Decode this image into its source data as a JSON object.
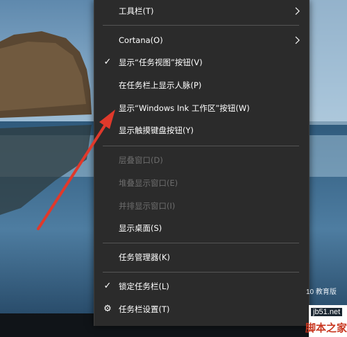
{
  "menu": {
    "toolbar_label": "工具栏(T)",
    "cortana_label": "Cortana(O)",
    "task_view_label": "显示“任务视图”按钮(V)",
    "people_label": "在任务栏上显示人脉(P)",
    "ink_label": "显示“Windows Ink 工作区”按钮(W)",
    "touch_kbd_label": "显示触摸键盘按钮(Y)",
    "cascade_label": "层叠窗口(D)",
    "stacked_label": "堆叠显示窗口(E)",
    "side_by_side_label": "并排显示窗口(I)",
    "show_desktop_label": "显示桌面(S)",
    "task_manager_label": "任务管理器(K)",
    "lock_taskbar_label": "锁定任务栏(L)",
    "taskbar_settings_label": "任务栏设置(T)"
  },
  "watermark": {
    "left_text": "10 教育版",
    "site": "jb51.net",
    "brand": "脚本之家"
  },
  "colors": {
    "menu_bg": "#2b2b2b",
    "text": "#ffffff",
    "disabled_text": "#6d6d6d",
    "arrow": "#e0392b"
  },
  "icons": {
    "check": "checkmark-icon",
    "gear": "gear-icon",
    "chevron": "chevron-right-icon"
  }
}
